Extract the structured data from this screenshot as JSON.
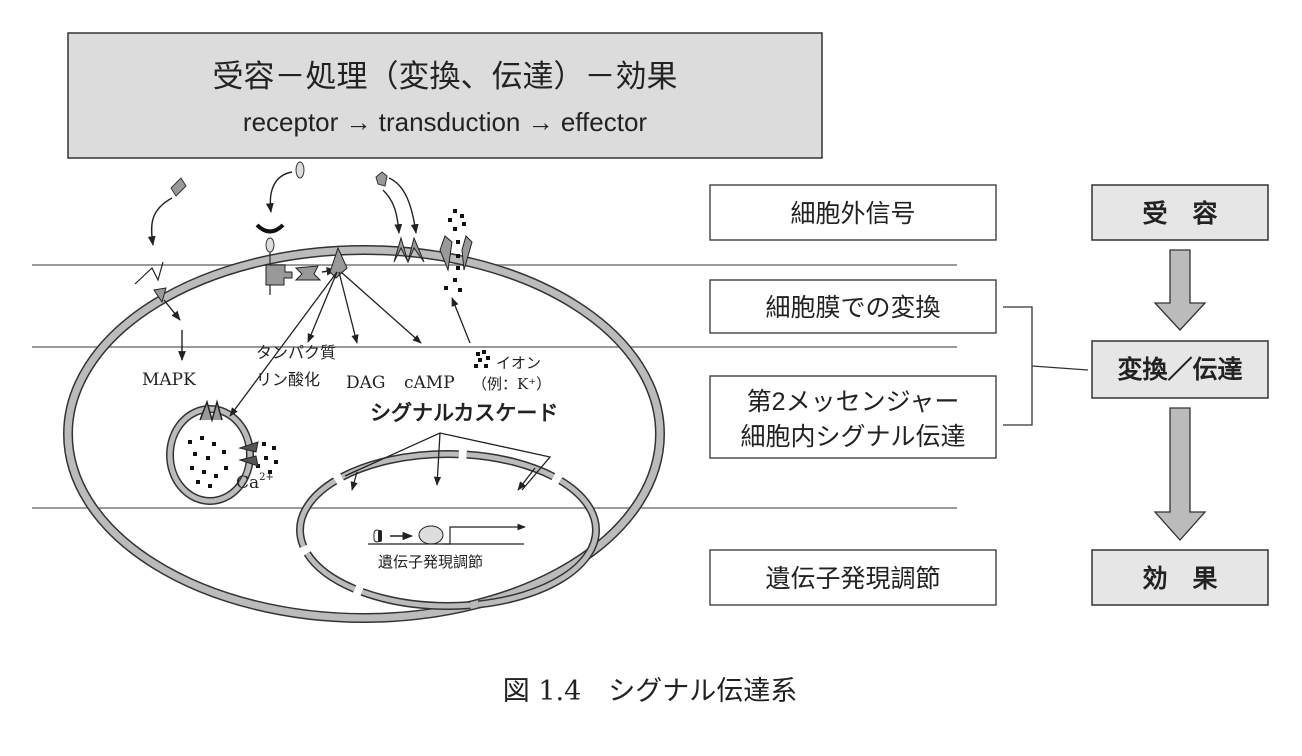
{
  "header": {
    "title": "受容－処理（変換、伝達）－効果",
    "subtitle": "receptor → transduction → effector"
  },
  "cell_labels": {
    "mapk": "MAPK",
    "protein": "タンパク質",
    "phosphorylation": "リン酸化",
    "dag": "DAG",
    "camp": "cAMP",
    "ion": "イオン",
    "ion_example": "（例：K⁺）",
    "cascade": "シグナルカスケード",
    "calcium": "Ca",
    "calcium_sup": "2+",
    "gene_regulation": "遺伝子発現調節"
  },
  "stage_boxes": [
    {
      "label": "細胞外信号"
    },
    {
      "label": "細胞膜での変換"
    },
    {
      "label": "第2メッセンジャー",
      "label2": "細胞内シグナル伝達"
    },
    {
      "label": "遺伝子発現調節"
    }
  ],
  "flow_boxes": [
    {
      "label": "受　容"
    },
    {
      "label": "変換／伝達"
    },
    {
      "label": "効　果"
    }
  ],
  "caption": "図 1.4　シグナル伝達系",
  "colors": {
    "box_fill": "#dcdcdc",
    "membrane": "#b8b8b8",
    "line": "#9a9a9a",
    "ink": "#222222"
  }
}
